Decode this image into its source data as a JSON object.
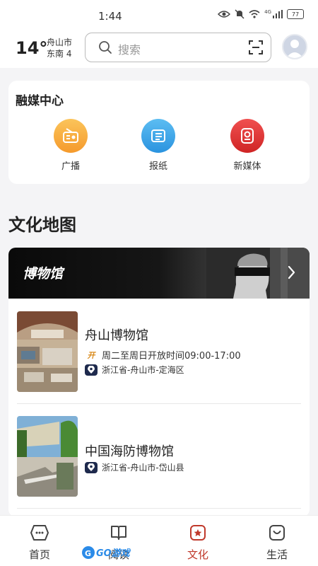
{
  "status": {
    "time": "1:44",
    "battery": "77",
    "network": "4G"
  },
  "header": {
    "temperature": "14°",
    "city": "舟山市",
    "wind": "东南 4",
    "search_placeholder": "搜索"
  },
  "media_center": {
    "title": "融媒中心",
    "items": [
      {
        "label": "广播",
        "icon": "radio-icon",
        "color": "#f7a93b"
      },
      {
        "label": "报纸",
        "icon": "newspaper-icon",
        "color": "#3aa3e8"
      },
      {
        "label": "新媒体",
        "icon": "new-media-icon",
        "color": "#e23b3b"
      }
    ]
  },
  "culture_map": {
    "title": "文化地图",
    "banner": {
      "label": "博物馆"
    },
    "museums": [
      {
        "name": "舟山博物馆",
        "hours_tag": "开",
        "hours": "周二至周日开放时间09:00-17:00",
        "address": "浙江省-舟山市-定海区"
      },
      {
        "name": "中国海防博物馆",
        "address": "浙江省-舟山市-岱山县"
      }
    ]
  },
  "tabbar": {
    "tabs": [
      {
        "label": "首页",
        "icon": "home-icon",
        "active": false
      },
      {
        "label": "阅读",
        "icon": "book-icon",
        "active": false
      },
      {
        "label": "文化",
        "icon": "culture-icon",
        "active": true
      },
      {
        "label": "生活",
        "icon": "life-icon",
        "active": false
      }
    ],
    "active_color": "#c0392b"
  },
  "watermark": {
    "text": "GO游戏"
  }
}
